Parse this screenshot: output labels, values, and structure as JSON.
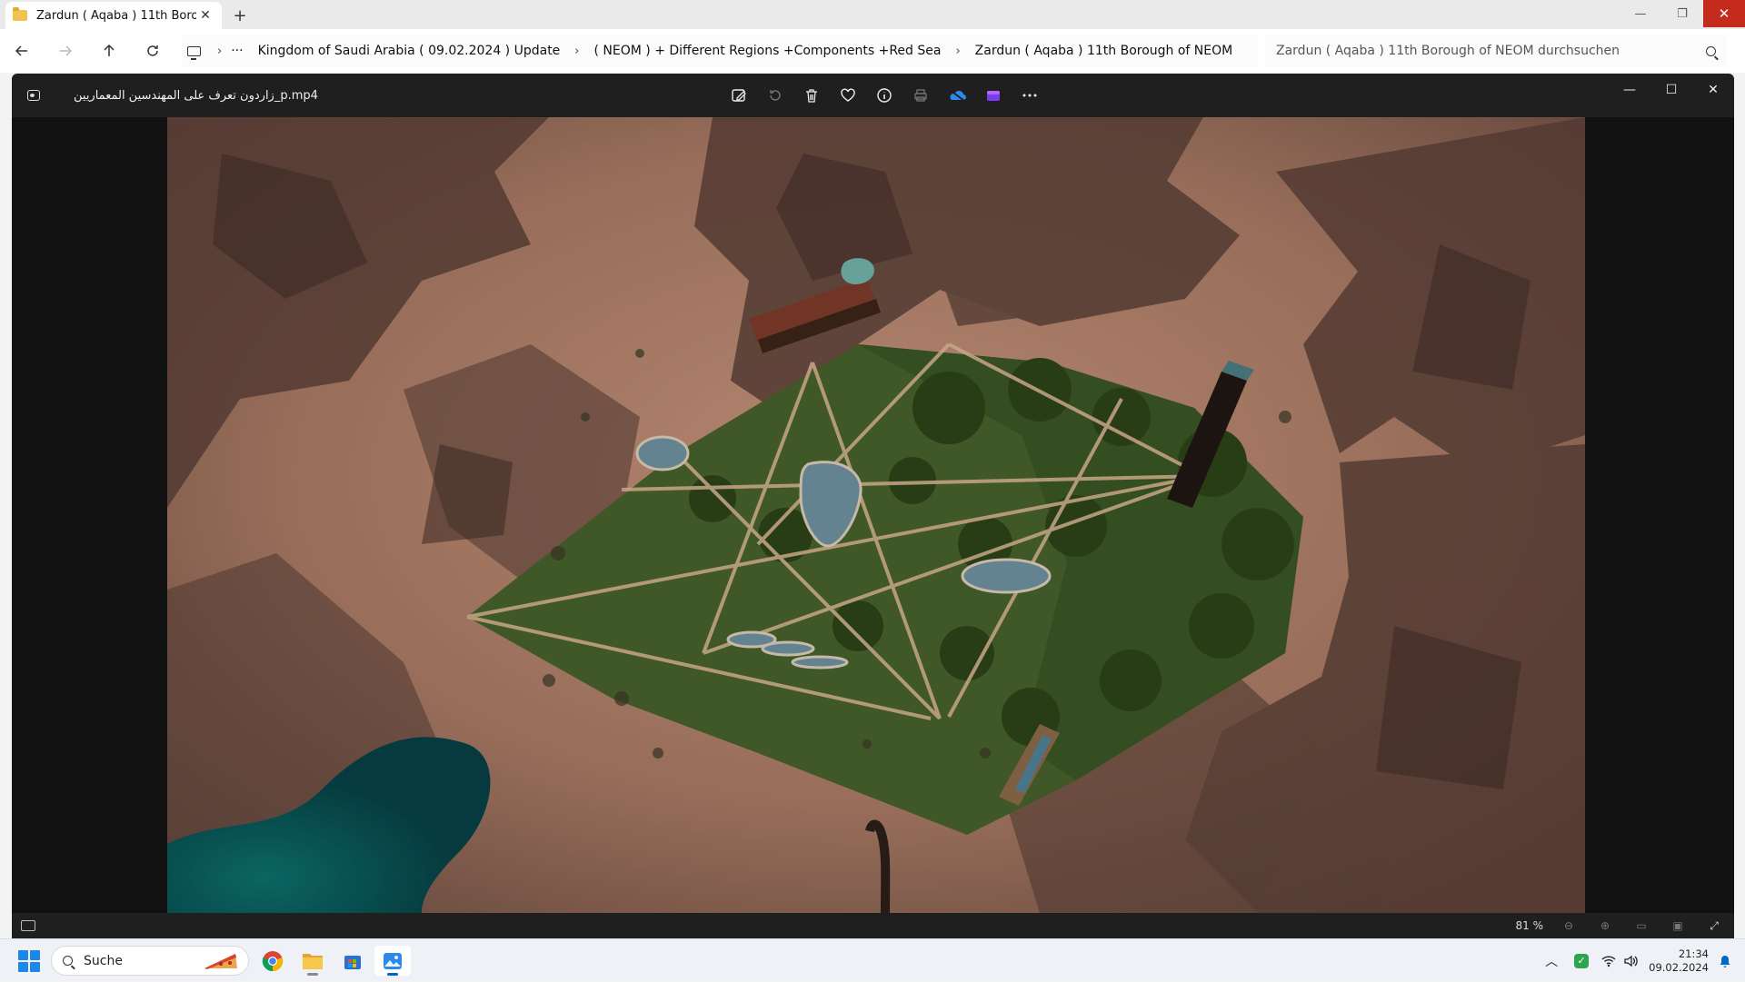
{
  "explorer": {
    "tab_title": "Zardun ( Aqaba )  11th Borough of NEOM",
    "breadcrumbs": [
      "Kingdom of Saudi Arabia ( 09.02.2024 ) Update",
      "( NEOM ) + Different Regions +Components +Red Sea",
      "Zardun ( Aqaba )  11th Borough of NEOM"
    ],
    "ellipsis": "···",
    "search_placeholder": "Zardun ( Aqaba )  11th Borough of NEOM durchsuchen"
  },
  "photos": {
    "filename": "زاردون  تعرف على المهندسين المعماريين_p.mp4",
    "zoom": "81 %"
  },
  "taskbar": {
    "search_label": "Suche",
    "time": "21:34",
    "date": "09.02.2024"
  },
  "colors": {
    "close_red": "#c42b1c",
    "accent_blue": "#0067c0",
    "desert": "#b5826a",
    "park_green": "#3d5a2a",
    "sea": "#0f5a5a"
  }
}
